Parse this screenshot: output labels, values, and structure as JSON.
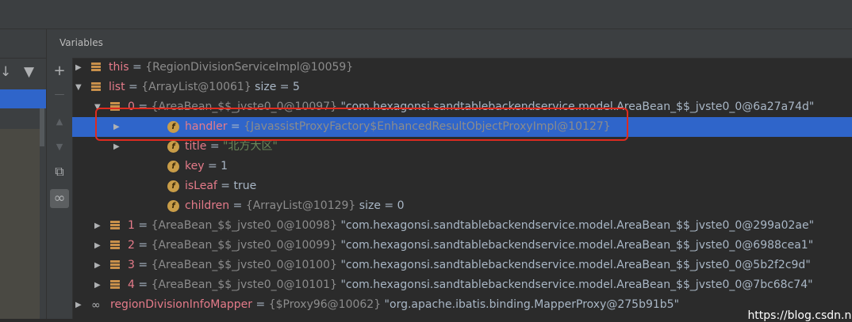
{
  "panel": {
    "title": "Variables"
  },
  "tree": [
    {
      "indent": 0,
      "arrow": "▶",
      "icon": "bars",
      "name": "this",
      "value": "{RegionDivisionServiceImpl@10059}",
      "extra": ""
    },
    {
      "indent": 0,
      "arrow": "▼",
      "icon": "bars",
      "name": "list",
      "value": "{ArrayList@10061}",
      "extra": " size = 5"
    },
    {
      "indent": 1,
      "arrow": "▼",
      "icon": "bars",
      "name": "0",
      "value": "{AreaBean_$$_jvste0_0@10097}",
      "extra": " \"com.hexagonsi.sandtablebackendservice.model.AreaBean_$$_jvste0_0@6a27a74d\""
    },
    {
      "indent": 2,
      "arrow": "▶",
      "icon": "f",
      "name": "handler",
      "value": "{JavassistProxyFactory$EnhancedResultObjectProxyImpl@10127}",
      "extra": "",
      "selected": true
    },
    {
      "indent": 2,
      "arrow": "▶",
      "icon": "f",
      "name": "title",
      "value": "",
      "str": "\"北方大区\"",
      "extra": ""
    },
    {
      "indent": 2,
      "arrow": "",
      "icon": "f",
      "name": "key",
      "value": "",
      "plain": "1",
      "extra": ""
    },
    {
      "indent": 2,
      "arrow": "",
      "icon": "f",
      "name": "isLeaf",
      "value": "",
      "plain": "true",
      "extra": ""
    },
    {
      "indent": 2,
      "arrow": "",
      "icon": "f",
      "name": "children",
      "value": "{ArrayList@10129}",
      "extra": " size = 0"
    },
    {
      "indent": 1,
      "arrow": "▶",
      "icon": "bars",
      "name": "1",
      "value": "{AreaBean_$$_jvste0_0@10098}",
      "extra": " \"com.hexagonsi.sandtablebackendservice.model.AreaBean_$$_jvste0_0@299a02ae\""
    },
    {
      "indent": 1,
      "arrow": "▶",
      "icon": "bars",
      "name": "2",
      "value": "{AreaBean_$$_jvste0_0@10099}",
      "extra": " \"com.hexagonsi.sandtablebackendservice.model.AreaBean_$$_jvste0_0@6988cea1\""
    },
    {
      "indent": 1,
      "arrow": "▶",
      "icon": "bars",
      "name": "3",
      "value": "{AreaBean_$$_jvste0_0@10100}",
      "extra": " \"com.hexagonsi.sandtablebackendservice.model.AreaBean_$$_jvste0_0@5b2f2c9d\""
    },
    {
      "indent": 1,
      "arrow": "▶",
      "icon": "bars",
      "name": "4",
      "value": "{AreaBean_$$_jvste0_0@10101}",
      "extra": " \"com.hexagonsi.sandtablebackendservice.model.AreaBean_$$_jvste0_0@7bc68c74\""
    },
    {
      "indent": 0,
      "arrow": "▶",
      "icon": "glasses",
      "name": "regionDivisionInfoMapper",
      "value": "{$Proxy96@10062}",
      "extra": " \"org.apache.ibatis.binding.MapperProxy@275b91b5\""
    }
  ],
  "toolbar": {
    "add": "+",
    "remove": "—",
    "up": "▲",
    "down": "▼",
    "copy": "⧉",
    "watch": "∞"
  },
  "left_toolbar": {
    "sort": "↓",
    "filter": "▼"
  },
  "watermark": "https://blog.csdn.ne",
  "colors": {
    "selection": "#2f65ca",
    "highlight_box": "#e02b1f",
    "field_icon": "#c99d48"
  }
}
